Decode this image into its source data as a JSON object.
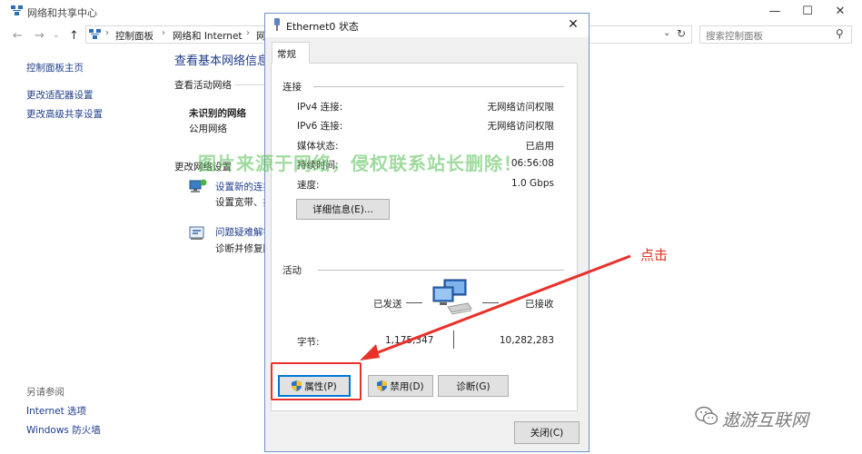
{
  "background_window": {
    "title": "网络和共享中心",
    "breadcrumbs": [
      "控制面板",
      "网络和 Internet",
      "网"
    ],
    "search_placeholder": "搜索控制面板",
    "sidebar": {
      "home": "控制面板主页",
      "links": [
        "更改适配器设置",
        "更改高级共享设置"
      ],
      "see_also_title": "另请参阅",
      "see_also": [
        "Internet 选项",
        "Windows 防火墙"
      ]
    },
    "main": {
      "title": "查看基本网络信息",
      "active_networks_label": "查看活动网络",
      "network_name": "未识别的网络",
      "network_type": "公用网络",
      "change_settings_label": "更改网络设置",
      "task1_link": "设置新的连接",
      "task1_desc": "设置宽带、拨",
      "task2_link": "问题疑难解答",
      "task2_desc": "诊断并修复网"
    }
  },
  "dialog": {
    "title": "Ethernet0 状态",
    "tab": "常规",
    "connection_group": "连接",
    "connection_rows": [
      {
        "label": "IPv4 连接:",
        "value": "无网络访问权限"
      },
      {
        "label": "IPv6 连接:",
        "value": "无网络访问权限"
      },
      {
        "label": "媒体状态:",
        "value": "已启用"
      },
      {
        "label": "持续时间:",
        "value": "06:56:08"
      },
      {
        "label": "速度:",
        "value": "1.0 Gbps"
      }
    ],
    "details_button": "详细信息(E)...",
    "activity_group": "活动",
    "sent_label": "已发送",
    "received_label": "已接收",
    "bytes_label": "字节:",
    "bytes_sent": "1,175,347",
    "bytes_received": "10,282,283",
    "properties_button": "属性(P)",
    "disable_button": "禁用(D)",
    "diagnose_button": "诊断(G)",
    "close_button": "关闭(C)"
  },
  "annotations": {
    "click_label": "点击",
    "watermark": "图片来源于网络，侵权联系站长删除！",
    "brand": "遨游互联网"
  },
  "colors": {
    "link_blue": "#1e3c8a",
    "annotation_red": "#e8312a",
    "dialog_border": "#6e93c8",
    "focus_blue": "#0078d7"
  }
}
